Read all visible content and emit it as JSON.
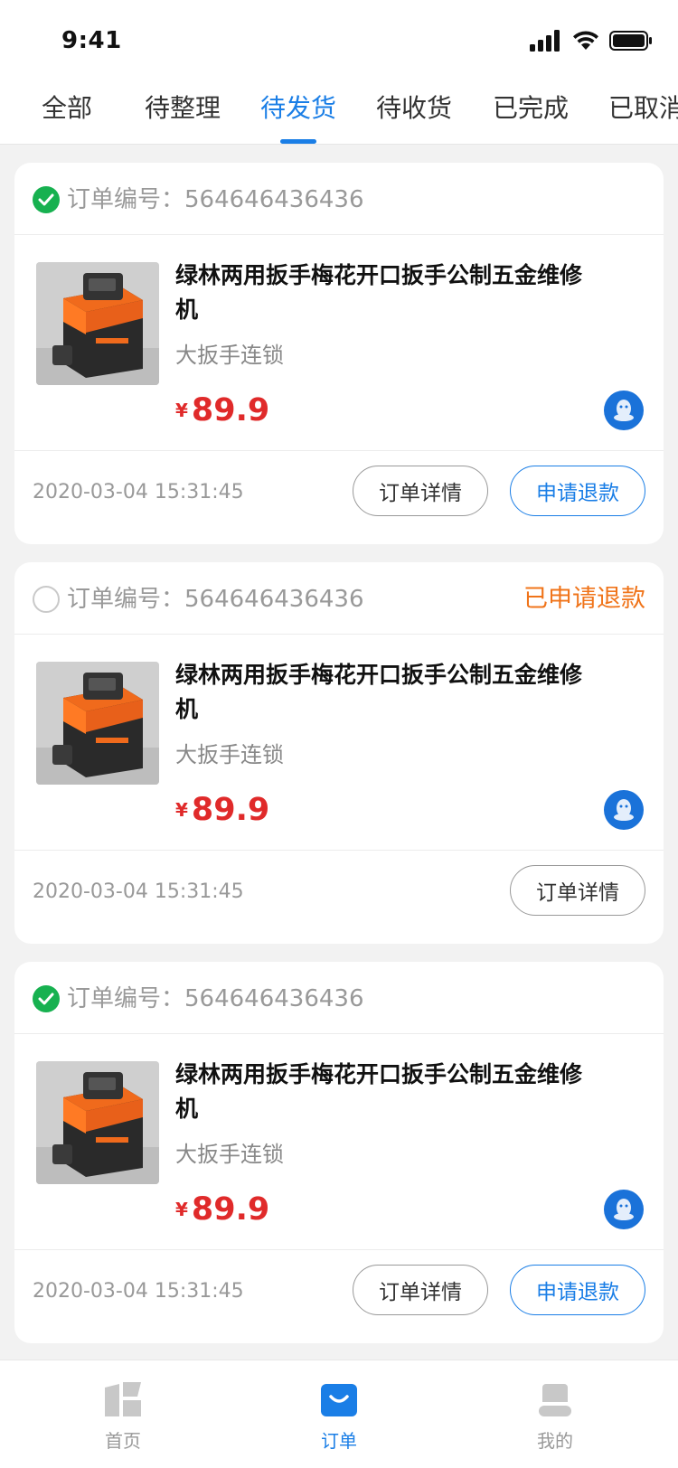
{
  "status_bar": {
    "time": "9:41"
  },
  "tabs": [
    {
      "label": "全部"
    },
    {
      "label": "待整理"
    },
    {
      "label": "待发货"
    },
    {
      "label": "待收货"
    },
    {
      "label": "已完成"
    },
    {
      "label": "已取消"
    }
  ],
  "active_tab": "待发货",
  "orders": [
    {
      "order_no_label": "订单编号：",
      "order_no": "564646436436",
      "checked": true,
      "status": "",
      "product_title": "绿林两用扳手梅花开口扳手公制五金维修机",
      "shop": "大扳手连锁",
      "currency": "¥",
      "price": "89.9",
      "time": "2020-03-04 15:31:45",
      "detail_label": "订单详情",
      "refund_label": "申请退款"
    },
    {
      "order_no_label": "订单编号：",
      "order_no": "564646436436",
      "checked": false,
      "status": "已申请退款",
      "product_title": "绿林两用扳手梅花开口扳手公制五金维修机",
      "shop": "大扳手连锁",
      "currency": "¥",
      "price": "89.9",
      "time": "2020-03-04 15:31:45",
      "detail_label": "订单详情"
    },
    {
      "order_no_label": "订单编号：",
      "order_no": "564646436436",
      "checked": true,
      "status": "",
      "product_title": "绿林两用扳手梅花开口扳手公制五金维修机",
      "shop": "大扳手连锁",
      "currency": "¥",
      "price": "89.9",
      "time": "2020-03-04 15:31:45",
      "detail_label": "订单详情",
      "refund_label": "申请退款"
    }
  ],
  "bottom_nav": [
    {
      "label": "首页",
      "icon": "home-icon"
    },
    {
      "label": "订单",
      "icon": "order-bag-icon"
    },
    {
      "label": "我的",
      "icon": "profile-icon"
    }
  ],
  "colors": {
    "accent": "#1a7ee6",
    "price": "#e02a2a",
    "status_refund": "#f0741a",
    "check": "#17b150"
  }
}
